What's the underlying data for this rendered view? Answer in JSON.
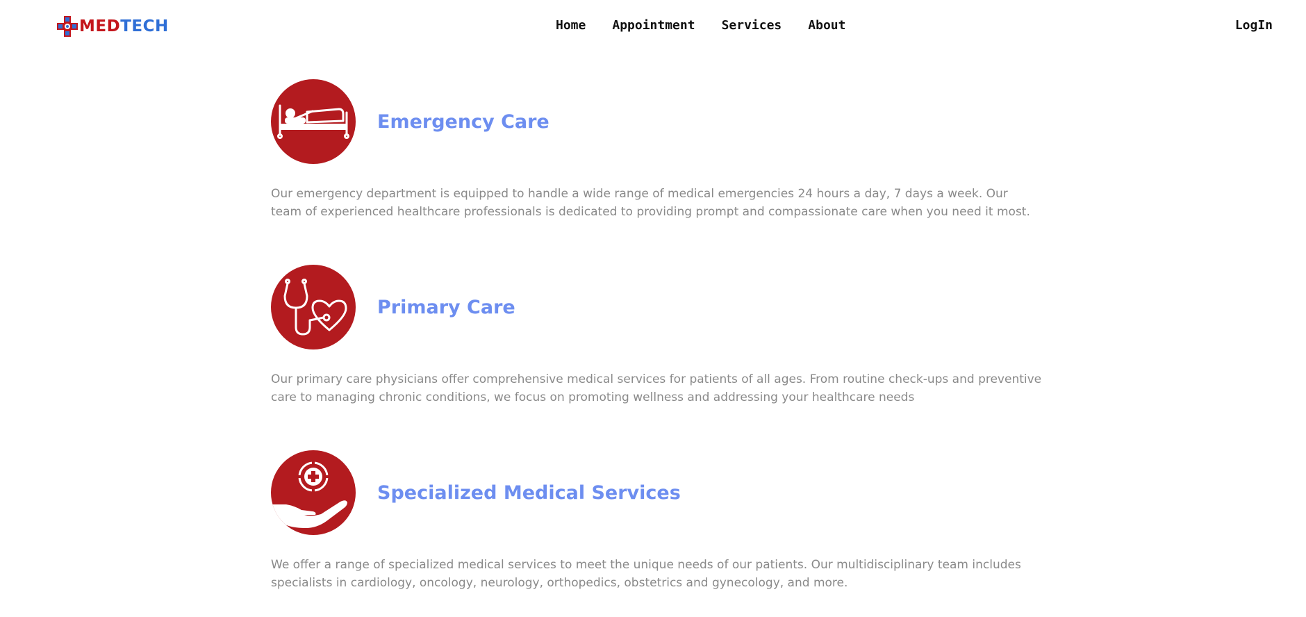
{
  "header": {
    "logo": {
      "text_part1": "MED",
      "text_part2": "TECH",
      "icon": "medical-cross-logo-icon",
      "colors": {
        "red": "#c4161c",
        "blue": "#2f6fd6"
      }
    },
    "nav": [
      {
        "label": "Home"
      },
      {
        "label": "Appointment"
      },
      {
        "label": "Services"
      },
      {
        "label": "About"
      }
    ],
    "login_label": "LogIn"
  },
  "services": [
    {
      "icon": "hospital-bed-icon",
      "title": "Emergency Care",
      "description": "Our emergency department is equipped to handle a wide range of medical emergencies 24 hours a day, 7 days a week. Our team of experienced healthcare professionals is dedicated to providing prompt and compassionate care when you need it most."
    },
    {
      "icon": "stethoscope-heart-icon",
      "title": "Primary Care",
      "description": "Our primary care physicians offer comprehensive medical services for patients of all ages. From routine check-ups and preventive care to managing chronic conditions, we focus on promoting wellness and addressing your healthcare needs"
    },
    {
      "icon": "hand-medical-cross-icon",
      "title": "Specialized Medical Services",
      "description": "We offer a range of specialized medical services to meet the unique needs of our patients. Our multidisciplinary team includes specialists in cardiology, oncology, neurology, orthopedics, obstetrics and gynecology, and more."
    }
  ],
  "theme": {
    "icon_bg": "#b31b1f",
    "title_color": "#6d8ef0",
    "text_color": "#8a8a8a"
  }
}
